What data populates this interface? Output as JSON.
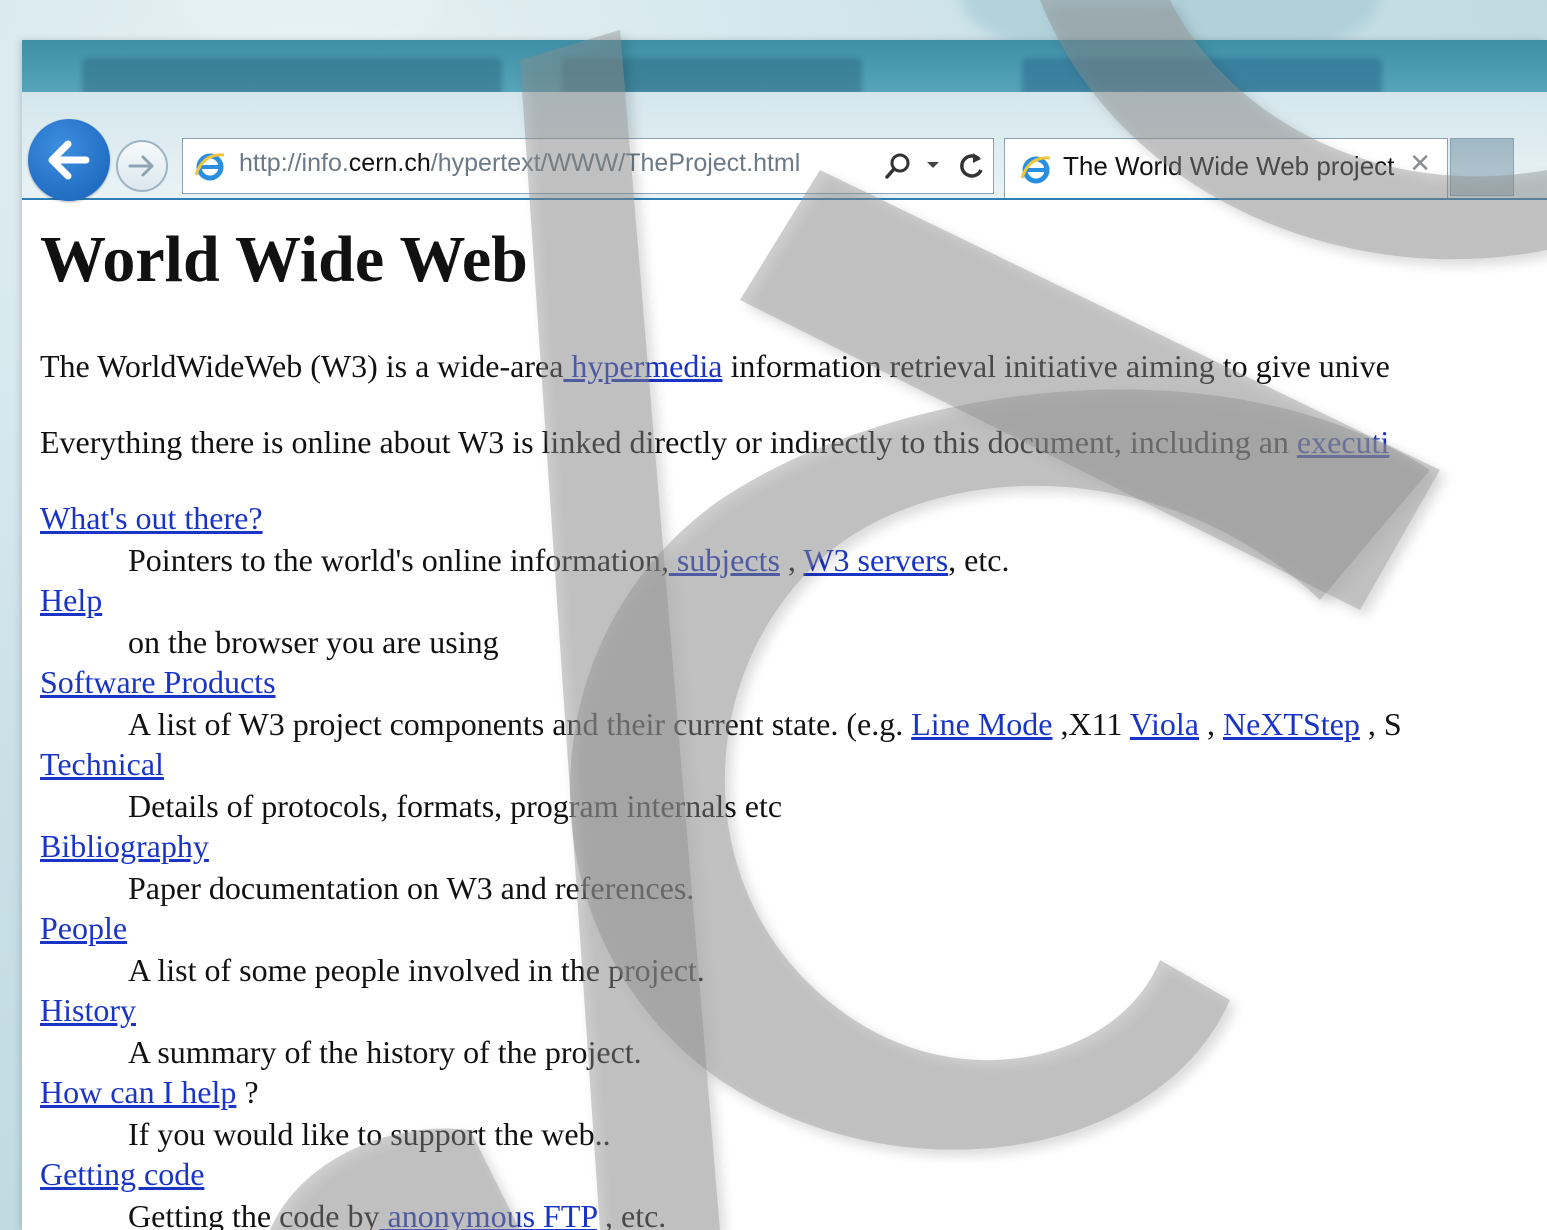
{
  "browser": {
    "back_icon": "back-arrow-icon",
    "forward_icon": "forward-arrow-icon",
    "address": {
      "prefix": "http://info.",
      "host": "cern.ch",
      "path": "/hypertext/WWW/TheProject.html"
    },
    "search_icon": "search-icon",
    "refresh_icon": "refresh-icon",
    "tab": {
      "title": "The World Wide Web project",
      "close_glyph": "✕"
    },
    "accent_color": "#2d7fb4"
  },
  "page": {
    "heading": "World Wide Web",
    "intro": {
      "before": "The WorldWideWeb (W3) is a wide-area",
      "link": " hypermedia",
      "after": " information retrieval initiative aiming to give unive"
    },
    "everything": {
      "before": "Everything there is online about W3 is linked directly or indirectly to this document, including an ",
      "link": "executi"
    },
    "items": [
      {
        "term": "What's out there?",
        "desc_before": "Pointers to the world's online information,",
        "links": [
          " subjects",
          "W3 servers"
        ],
        "desc_sep": " , ",
        "desc_after": ", etc."
      },
      {
        "term": "Help",
        "desc": "on the browser you are using"
      },
      {
        "term": "Software Products",
        "desc_before": "A list of W3 project components and their current state. (e.g. ",
        "link1": "Line Mode",
        "mid1": " ,X11 ",
        "link2": "Viola",
        "mid2": " , ",
        "link3": "NeXTStep",
        "tail": " , S"
      },
      {
        "term": "Technical",
        "desc": "Details of protocols, formats, program internals etc"
      },
      {
        "term": "Bibliography",
        "desc": "Paper documentation on W3 and references."
      },
      {
        "term": "People",
        "desc": "A list of some people involved in the project."
      },
      {
        "term": "History",
        "desc": "A summary of the history of the project."
      },
      {
        "term": "How can I help",
        "term_suffix": " ?",
        "desc": "If you would like to support the web.."
      },
      {
        "term": "Getting code",
        "desc_before": "Getting the code by",
        "link": " anonymous FTP",
        "desc_after": " , etc."
      }
    ],
    "link_color": "#1a35c6"
  }
}
